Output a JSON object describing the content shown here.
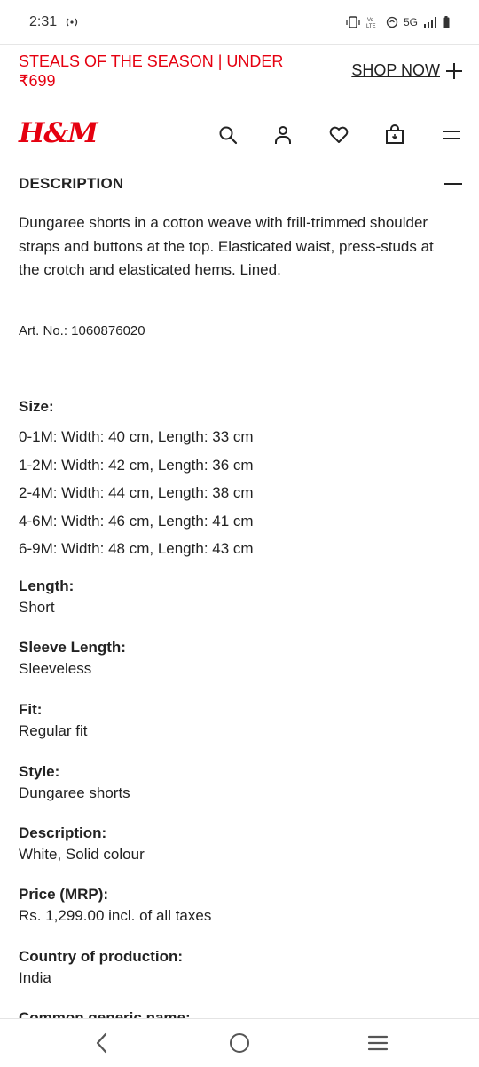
{
  "status": {
    "time": "2:31",
    "network": "5G"
  },
  "promo": {
    "text": "STEALS OF THE SEASON | UNDER ₹699",
    "cta": "SHOP NOW"
  },
  "brand": {
    "logo": "H&M"
  },
  "header": {
    "icons": [
      "search-icon",
      "account-icon",
      "favorites-icon",
      "bag-icon",
      "menu-icon"
    ]
  },
  "description": {
    "title": "DESCRIPTION",
    "text": "Dungaree shorts in a cotton weave with frill-trimmed shoulder straps and buttons at the top. Elasticated waist, press-studs at the crotch and elasticated hems. Lined.",
    "art_no": "Art. No.: 1060876020"
  },
  "size": {
    "label": "Size:",
    "rows": [
      "0-1M: Width: 40 cm, Length: 33 cm",
      "1-2M: Width: 42 cm, Length: 36 cm",
      "2-4M: Width: 44 cm, Length: 38 cm",
      "4-6M: Width: 46 cm, Length: 41 cm",
      "6-9M: Width: 48 cm, Length: 43 cm"
    ]
  },
  "attributes": [
    {
      "label": "Length:",
      "value": "Short"
    },
    {
      "label": "Sleeve Length:",
      "value": "Sleeveless"
    },
    {
      "label": "Fit:",
      "value": "Regular fit"
    },
    {
      "label": "Style:",
      "value": "Dungaree shorts"
    },
    {
      "label": "Description:",
      "value": "White, Solid colour"
    },
    {
      "label": "Price (MRP):",
      "value": "Rs. 1,299.00 incl. of all taxes"
    },
    {
      "label": "Country of production:",
      "value": "India"
    }
  ],
  "partial_label": "Common generic name:",
  "colors": {
    "brand_red": "#e50010",
    "text": "#222222"
  }
}
